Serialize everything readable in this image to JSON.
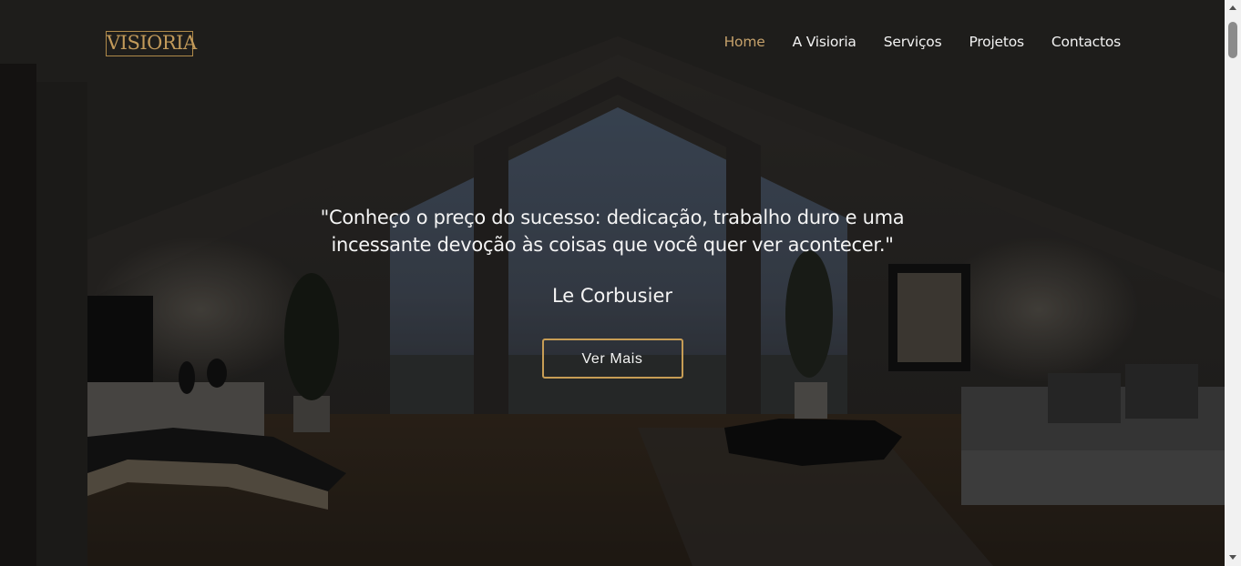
{
  "brand": {
    "logo_text": "VISIORIA",
    "accent_color": "#c4a06a"
  },
  "nav": {
    "items": [
      {
        "label": "Home",
        "active": true
      },
      {
        "label": "A Visioria",
        "active": false
      },
      {
        "label": "Serviços",
        "active": false
      },
      {
        "label": "Projetos",
        "active": false
      },
      {
        "label": "Contactos",
        "active": false
      }
    ]
  },
  "hero": {
    "quote_line1": "\"Conheço o preço do sucesso: dedicação, trabalho duro e uma",
    "quote_line2": "incessante devoção às coisas que você quer ver acontecer.\"",
    "author": "Le Corbusier",
    "cta_label": "Ver Mais",
    "background_image": "dim-living-room-interior"
  },
  "scrollbar": {
    "up_icon": "chevron-up-icon",
    "down_icon": "chevron-down-icon"
  }
}
